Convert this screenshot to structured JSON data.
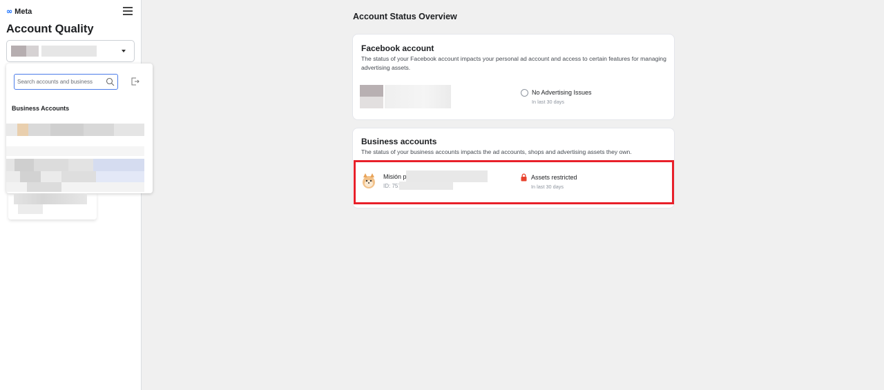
{
  "brand": {
    "logo_glyph": "∞",
    "name": "Meta"
  },
  "sidebar": {
    "title": "Account Quality",
    "dropdown": {
      "search_placeholder": "Search accounts and business",
      "section_label": "Business Accounts"
    }
  },
  "main": {
    "title": "Account Status Overview",
    "facebook_card": {
      "title": "Facebook account",
      "description": "The status of your Facebook account impacts your personal ad account and access to certain features for managing advertising assets.",
      "status": "No Advertising Issues",
      "period": "In last 30 days"
    },
    "business_card": {
      "title": "Business accounts",
      "description": "The status of your business accounts impacts the ad accounts, shops and advertising assets they own.",
      "account_name": "Misión p",
      "account_id": "ID: 7573",
      "status": "Assets restricted",
      "period": "In last 30 days"
    }
  },
  "colors": {
    "accent": "#0866ff",
    "highlight": "#e8202a",
    "restricted": "#e8422d"
  },
  "icons": [
    "meta-logo-icon",
    "hamburger-menu-icon",
    "chevron-down-icon",
    "search-icon",
    "exit-icon",
    "status-radio-icon",
    "lock-icon",
    "business-avatar-icon"
  ]
}
